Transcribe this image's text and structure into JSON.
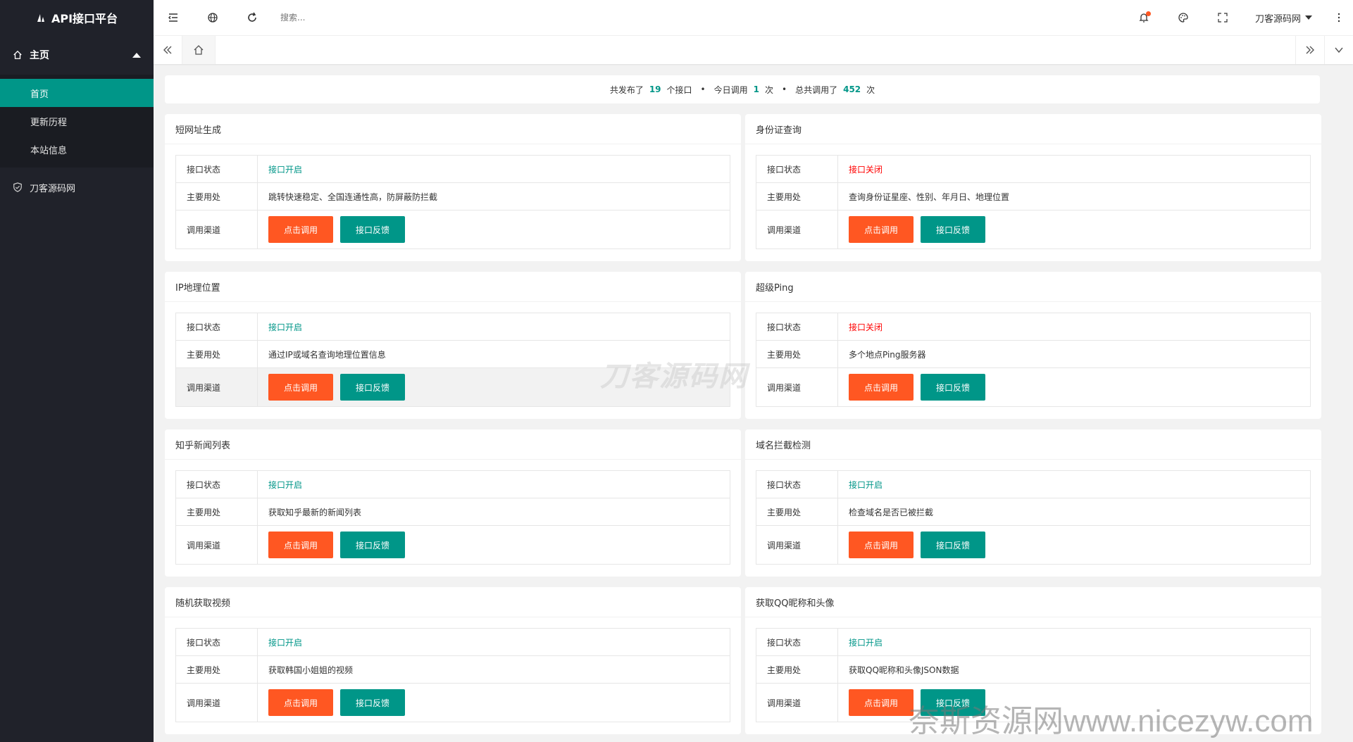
{
  "app": {
    "title": "API接口平台"
  },
  "sidebar": {
    "group": "主页",
    "sub_items": [
      {
        "label": "首页",
        "active": true
      },
      {
        "label": "更新历程",
        "active": false
      },
      {
        "label": "本站信息",
        "active": false
      }
    ],
    "bottom_item": "刀客源码网"
  },
  "header": {
    "search_placeholder": "搜索...",
    "user": "刀客源码网"
  },
  "stats": {
    "p1": "共发布了",
    "published": "19",
    "p2": "个接口",
    "p3": "今日调用",
    "today": "1",
    "p4": "次",
    "p5": "总共调用了",
    "total": "452",
    "p6": "次"
  },
  "labels": {
    "status": "接口状态",
    "usage": "主要用处",
    "channel": "调用渠道",
    "call_btn": "点击调用",
    "feedback_btn": "接口反馈",
    "open": "接口开启",
    "closed": "接口关闭"
  },
  "cards": [
    {
      "title": "短网址生成",
      "status": "接口开启",
      "open": true,
      "usage": "跳转快速稳定、全国连通性高，防屏蔽防拦截"
    },
    {
      "title": "身份证查询",
      "status": "接口关闭",
      "open": false,
      "usage": "查询身份证星座、性别、年月日、地理位置"
    },
    {
      "title": "IP地理位置",
      "status": "接口开启",
      "open": true,
      "usage": "通过IP或域名查询地理位置信息"
    },
    {
      "title": "超级Ping",
      "status": "接口关闭",
      "open": false,
      "usage": "多个地点Ping服务器"
    },
    {
      "title": "知乎新闻列表",
      "status": "接口开启",
      "open": true,
      "usage": "获取知乎最新的新闻列表"
    },
    {
      "title": "域名拦截检测",
      "status": "接口开启",
      "open": true,
      "usage": "检查域名是否已被拦截"
    },
    {
      "title": "随机获取视频",
      "status": "接口开启",
      "open": true,
      "usage": "获取韩国小姐姐的视频"
    },
    {
      "title": "获取QQ昵称和头像",
      "status": "接口开启",
      "open": true,
      "usage": "获取QQ昵称和头像JSON数据"
    }
  ],
  "watermarks": {
    "center": "刀客源码网",
    "bottom": "奈斯资源网www.nicezyw.com"
  },
  "colors": {
    "accent": "#009688",
    "orange": "#ff5722",
    "sidebar": "#20222a",
    "closed": "#ff0000"
  }
}
